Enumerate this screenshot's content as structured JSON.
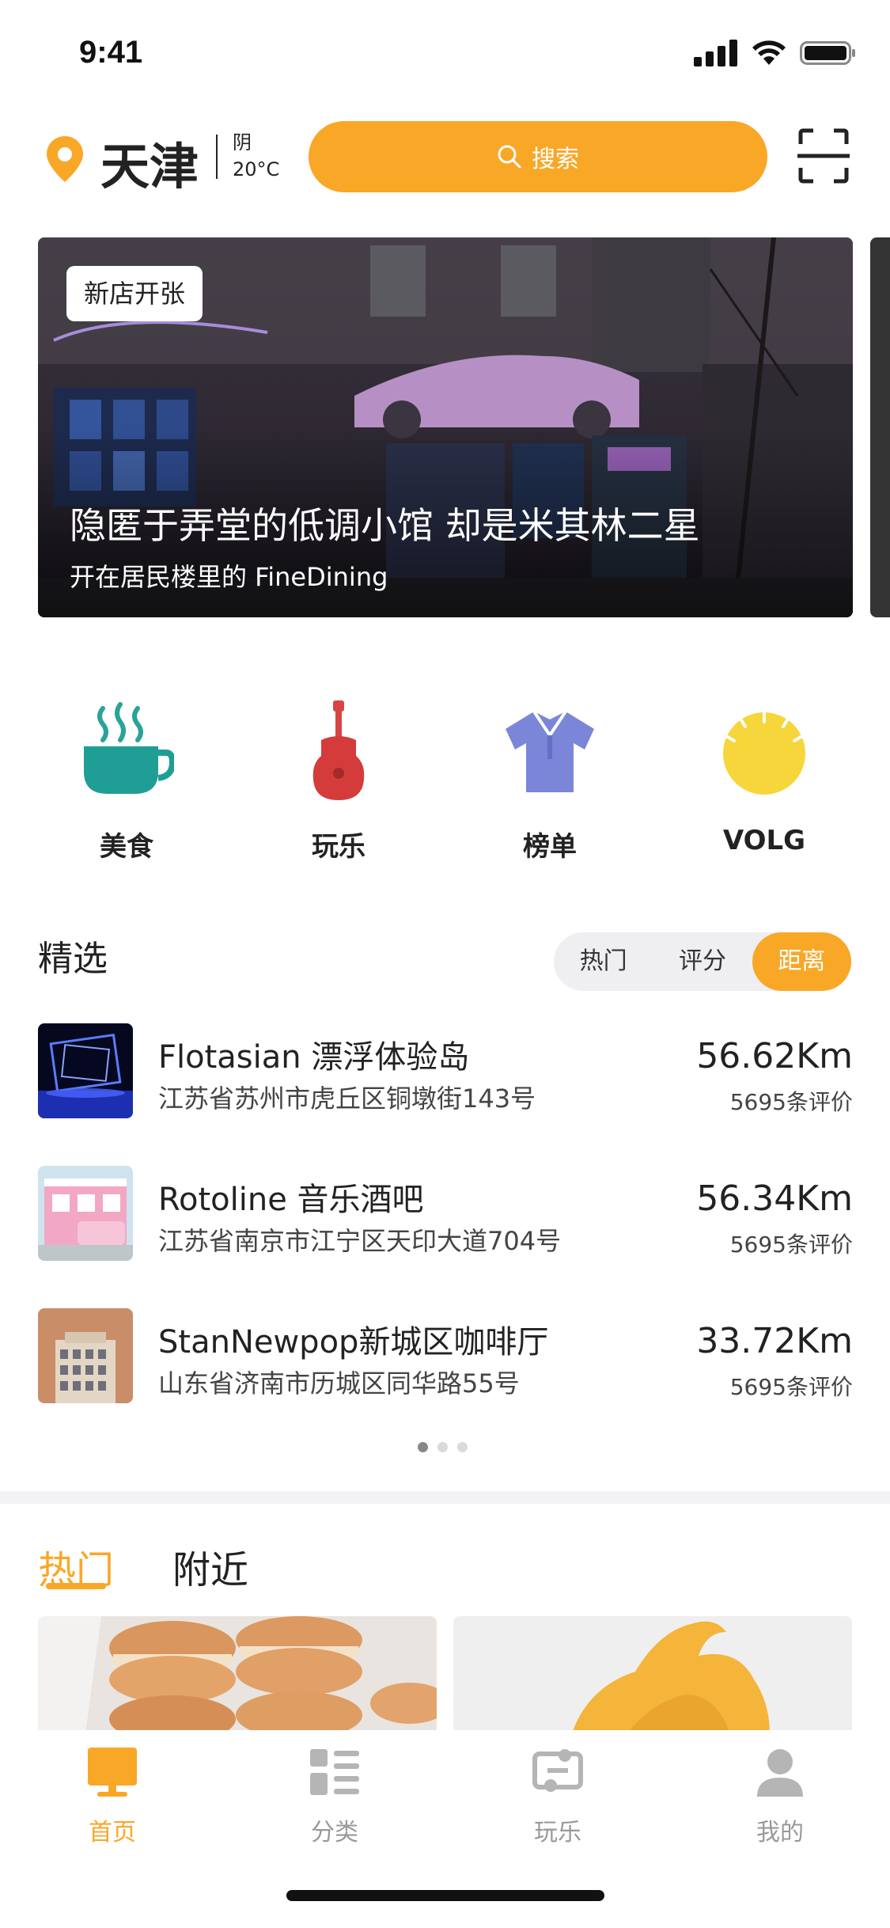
{
  "status_bar": {
    "time": "9:41"
  },
  "header": {
    "city": "天津",
    "weather": "阴",
    "temperature": "20°C",
    "search_label": "搜索"
  },
  "banner": {
    "badge": "新店开张",
    "title": "隐匿于弄堂的低调小馆 却是米其林二星",
    "subtitle": "开在居民楼里的 FineDining"
  },
  "categories": [
    {
      "label": "美食",
      "icon": "coffee-cup-icon"
    },
    {
      "label": "玩乐",
      "icon": "guitar-icon"
    },
    {
      "label": "榜单",
      "icon": "shirt-icon"
    },
    {
      "label": "VOLG",
      "icon": "sun-icon"
    }
  ],
  "featured": {
    "title": "精选",
    "sort_tabs": [
      "热门",
      "评分",
      "距离"
    ],
    "active_sort": "距离",
    "items": [
      {
        "name": "Flotasian 漂浮体验岛",
        "address": "江苏省苏州市虎丘区铜墩街143号",
        "distance": "56.62Km",
        "reviews": "5695条评价"
      },
      {
        "name": "Rotoline 音乐酒吧",
        "address": "江苏省南京市江宁区天印大道704号",
        "distance": "56.34Km",
        "reviews": "5695条评价"
      },
      {
        "name": "StanNewpop新城区咖啡厅",
        "address": "山东省济南市历城区同华路55号",
        "distance": "33.72Km",
        "reviews": "5695条评价"
      }
    ],
    "page_count": 3,
    "current_page": 1
  },
  "hot_tabs": {
    "hot": "热门",
    "nearby": "附近"
  },
  "tab_bar": [
    {
      "label": "首页",
      "icon": "home-monitor-icon",
      "active": true
    },
    {
      "label": "分类",
      "icon": "category-list-icon",
      "active": false
    },
    {
      "label": "玩乐",
      "icon": "play-switch-icon",
      "active": false
    },
    {
      "label": "我的",
      "icon": "user-icon",
      "active": false
    }
  ],
  "colors": {
    "accent": "#F9A727",
    "text": "#222222",
    "muted": "#999999"
  }
}
